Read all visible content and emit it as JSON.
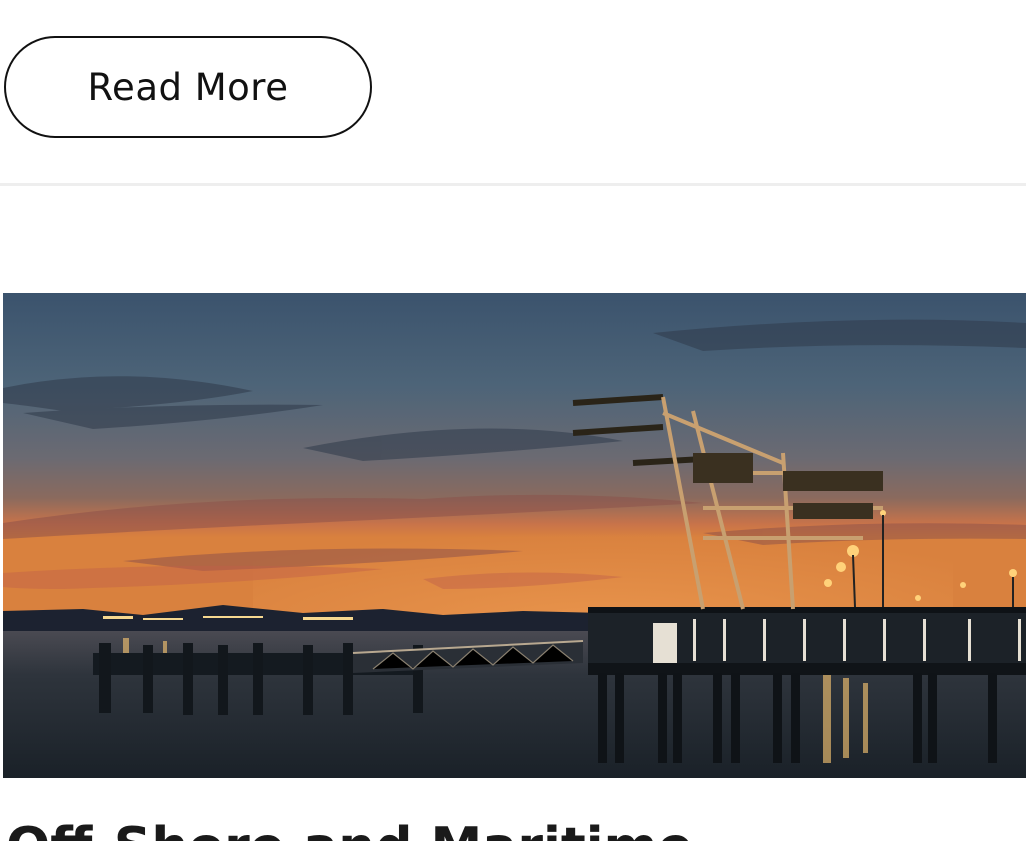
{
  "post": {
    "read_more_label": "Read More",
    "title": "Off-Shore and Maritime"
  },
  "colors": {
    "text": "#111111",
    "divider": "#eeeeee",
    "sky_top": "#3e5670",
    "sunset_orange": "#e07a3a",
    "water": "#1e2830"
  },
  "hero_image": {
    "subject": "port-cranes-at-sunset"
  }
}
